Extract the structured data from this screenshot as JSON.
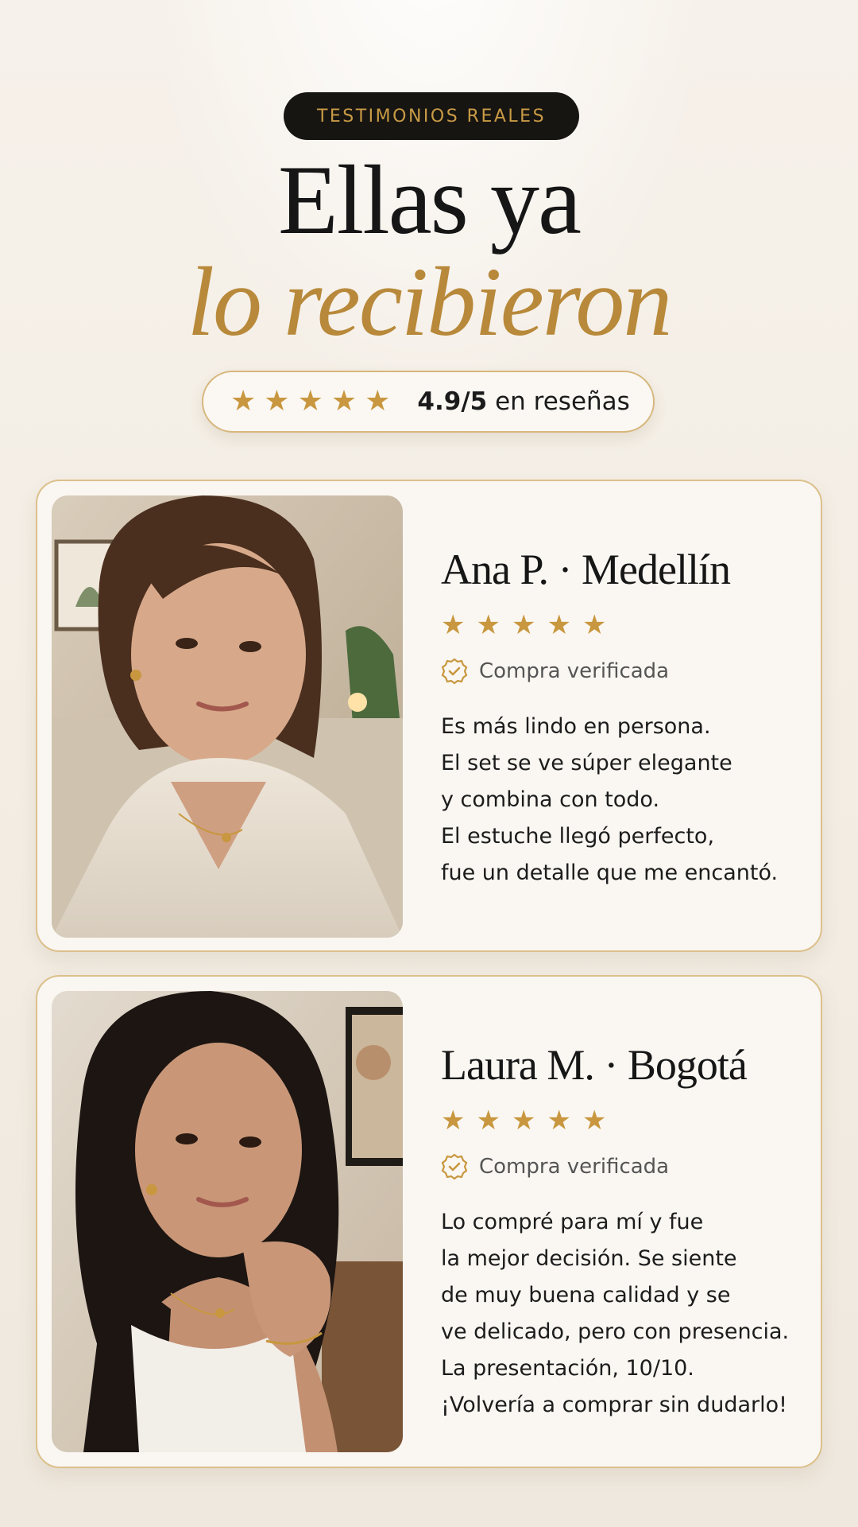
{
  "header": {
    "badge": "TESTIMONIOS REALES",
    "title_line1": "Ellas ya",
    "title_line2": "lo recibieron"
  },
  "rating": {
    "stars": 5,
    "score": "4.9/5",
    "suffix": "en reseñas"
  },
  "reviews": [
    {
      "name": "Ana P. · Medellín",
      "stars": 5,
      "verified_label": "Compra verificada",
      "lines": [
        "Es más lindo en persona.",
        "El set se ve súper elegante",
        "y combina con todo.",
        "El estuche llegó perfecto,",
        "fue un detalle que me encantó."
      ]
    },
    {
      "name": "Laura M. · Bogotá",
      "stars": 5,
      "verified_label": "Compra verificada",
      "lines": [
        "Lo compré para mí y fue",
        "la mejor decisión. Se siente",
        "de muy buena calidad y se",
        "ve delicado, pero con presencia.",
        "La presentación, 10/10.",
        "¡Volvería a comprar sin dudarlo!"
      ]
    }
  ],
  "colors": {
    "gold": "#c8973f",
    "dark": "#171512",
    "card_bg": "#faf7f2"
  },
  "icons": {
    "star": "star-icon",
    "verified": "verified-check-icon"
  }
}
